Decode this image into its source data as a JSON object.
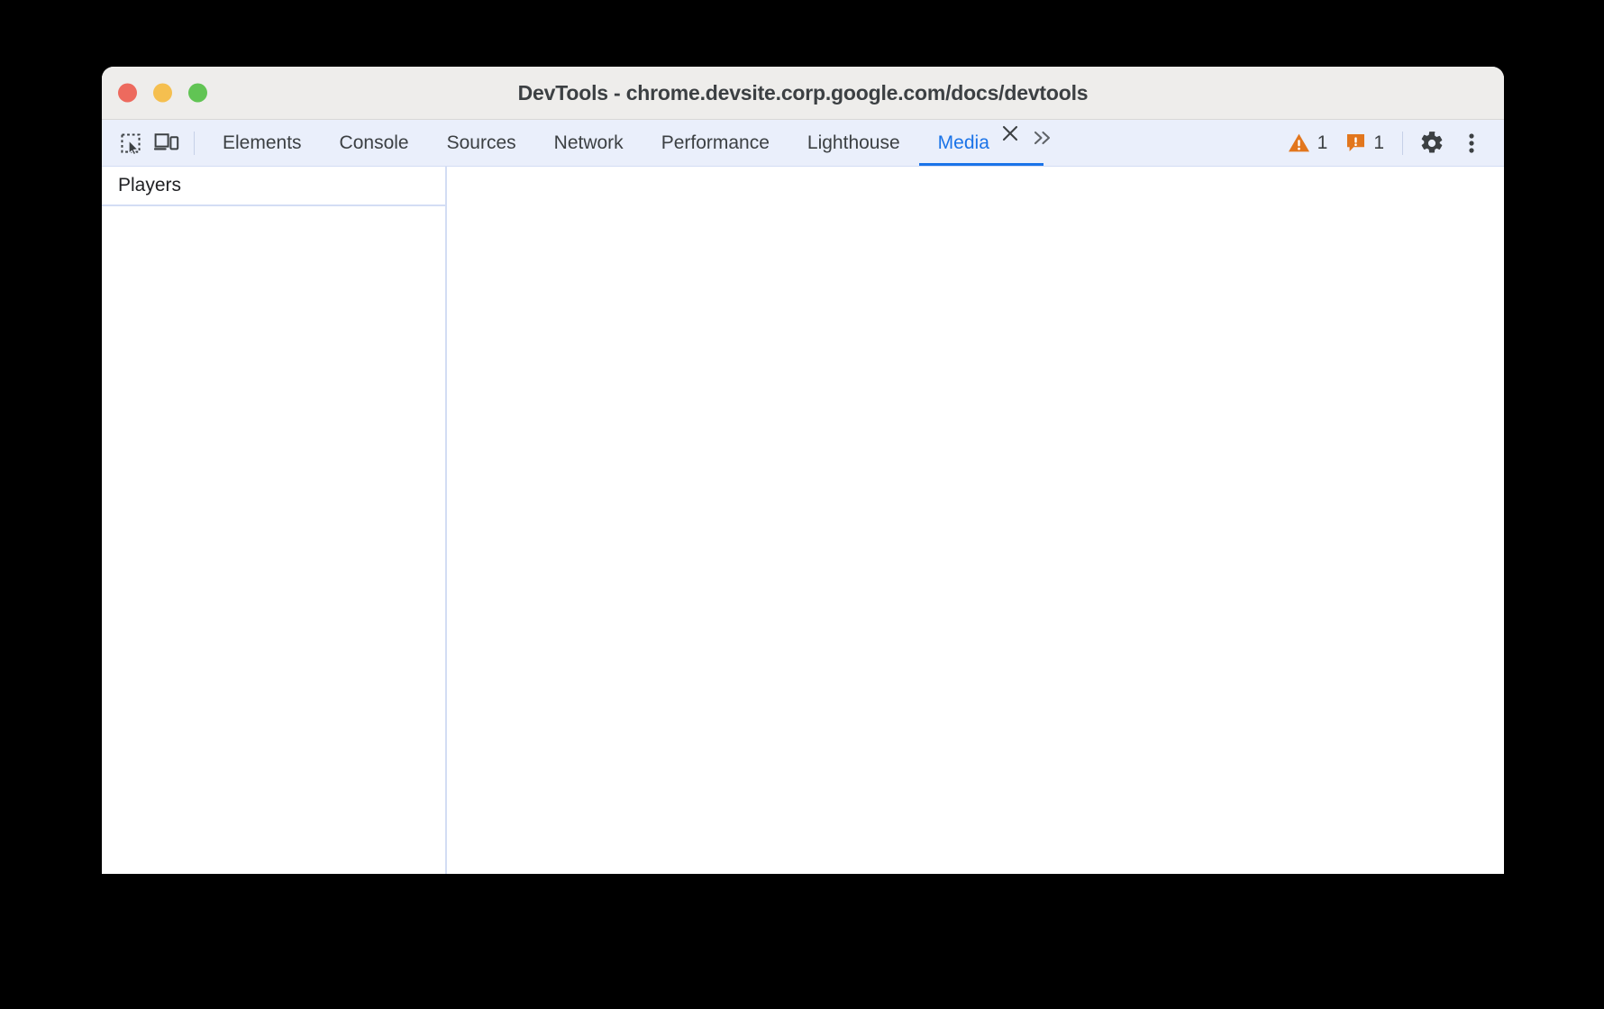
{
  "window": {
    "title": "DevTools - chrome.devsite.corp.google.com/docs/devtools",
    "traffic_lights": {
      "close_color": "#ed6a5e",
      "minimize_color": "#f5bf4f",
      "maximize_color": "#61c454"
    }
  },
  "toolbar": {
    "inspect_icon": "inspect-element-icon",
    "device_toggle_icon": "device-toolbar-icon",
    "tabs": [
      {
        "label": "Elements",
        "selected": false
      },
      {
        "label": "Console",
        "selected": false
      },
      {
        "label": "Sources",
        "selected": false
      },
      {
        "label": "Network",
        "selected": false
      },
      {
        "label": "Performance",
        "selected": false
      },
      {
        "label": "Lighthouse",
        "selected": false
      },
      {
        "label": "Media",
        "selected": true
      }
    ],
    "close_tab_icon": "close-icon",
    "overflow_icon": "chevron-double-right-icon",
    "warnings": {
      "icon": "warning-triangle-icon",
      "count": "1",
      "color": "#e2761d"
    },
    "issues": {
      "icon": "issue-exclamation-icon",
      "count": "1",
      "color": "#e2761d"
    },
    "settings_icon": "gear-icon",
    "more_options_icon": "kebab-menu-icon",
    "accent_color": "#1a73e8",
    "background_color": "#eaeffb"
  },
  "media_panel": {
    "sidebar": {
      "header": "Players",
      "players": []
    },
    "content": {
      "empty": ""
    }
  }
}
